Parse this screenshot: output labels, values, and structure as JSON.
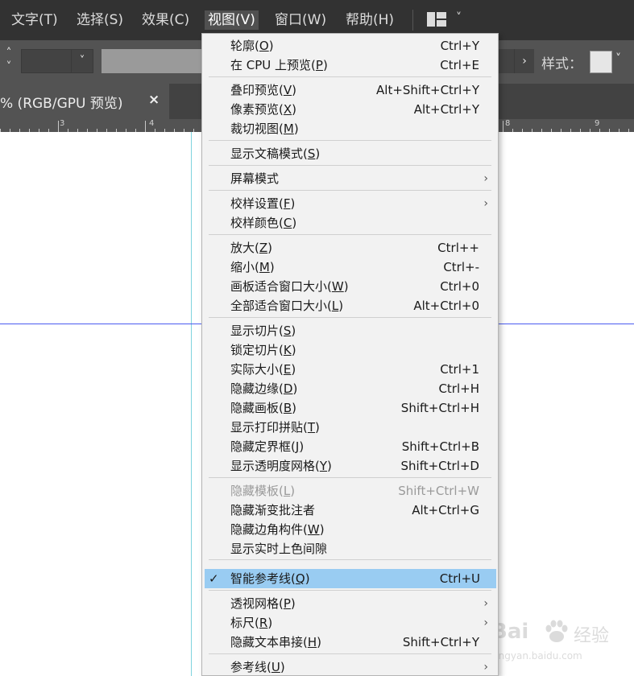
{
  "menubar": {
    "items": [
      "文字(T)",
      "选择(S)",
      "效果(C)",
      "视图(V)",
      "窗口(W)",
      "帮助(H)"
    ],
    "active_index": 3,
    "workspace_icon": "workspace-layout-icon",
    "workspace_caret": "˅"
  },
  "controlbar": {
    "style_label": "样式：",
    "spin_up": "˄",
    "spin_down": "˅",
    "select_caret": "˅",
    "next_arrow": "›",
    "style_caret": "˅"
  },
  "document_tab": {
    "title": "% (RGB/GPU 预览)",
    "close": "×"
  },
  "ruler": {
    "labels": [
      "3",
      "4",
      "8",
      "9"
    ]
  },
  "dropdown": {
    "items": [
      {
        "label": "轮廓",
        "key": "O",
        "shortcut": "Ctrl+Y"
      },
      {
        "label": "在 CPU 上预览",
        "key": "P",
        "shortcut": "Ctrl+E"
      },
      {
        "label": "叠印预览",
        "key": "V",
        "shortcut": "Alt+Shift+Ctrl+Y"
      },
      {
        "label": "像素预览",
        "key": "X",
        "shortcut": "Alt+Ctrl+Y"
      },
      {
        "label": "裁切视图",
        "key": "M",
        "shortcut": ""
      },
      {
        "label": "显示文稿模式",
        "key": "S",
        "shortcut": ""
      },
      {
        "label": "屏幕模式",
        "key": "",
        "shortcut": "",
        "submenu": true
      },
      {
        "label": "校样设置",
        "key": "F",
        "shortcut": "",
        "submenu": true
      },
      {
        "label": "校样颜色",
        "key": "C",
        "shortcut": ""
      },
      {
        "label": "放大",
        "key": "Z",
        "shortcut": "Ctrl++"
      },
      {
        "label": "缩小",
        "key": "M",
        "shortcut": "Ctrl+-"
      },
      {
        "label": "画板适合窗口大小",
        "key": "W",
        "shortcut": "Ctrl+0"
      },
      {
        "label": "全部适合窗口大小",
        "key": "L",
        "shortcut": "Alt+Ctrl+0"
      },
      {
        "label": "显示切片",
        "key": "S",
        "shortcut": ""
      },
      {
        "label": "锁定切片",
        "key": "K",
        "shortcut": ""
      },
      {
        "label": "实际大小",
        "key": "E",
        "shortcut": "Ctrl+1"
      },
      {
        "label": "隐藏边缘",
        "key": "D",
        "shortcut": "Ctrl+H"
      },
      {
        "label": "隐藏画板",
        "key": "B",
        "shortcut": "Shift+Ctrl+H"
      },
      {
        "label": "显示打印拼贴",
        "key": "T",
        "shortcut": ""
      },
      {
        "label": "隐藏定界框",
        "key": "J",
        "shortcut": "Shift+Ctrl+B"
      },
      {
        "label": "显示透明度网格",
        "key": "Y",
        "shortcut": "Shift+Ctrl+D"
      },
      {
        "label": "隐藏模板",
        "key": "L",
        "shortcut": "Shift+Ctrl+W",
        "disabled": true
      },
      {
        "label": "隐藏渐变批注者",
        "key": "",
        "shortcut": "Alt+Ctrl+G"
      },
      {
        "label": "隐藏边角构件",
        "key": "W",
        "shortcut": ""
      },
      {
        "label": "显示实时上色间隙",
        "key": "",
        "shortcut": ""
      },
      {
        "label": "智能参考线",
        "key": "Q",
        "shortcut": "Ctrl+U",
        "checked": true,
        "highlighted": true
      },
      {
        "label": "透视网格",
        "key": "P",
        "shortcut": "",
        "submenu": true
      },
      {
        "label": "标尺",
        "key": "R",
        "shortcut": "",
        "submenu": true
      },
      {
        "label": "隐藏文本串接",
        "key": "H",
        "shortcut": "Shift+Ctrl+Y"
      },
      {
        "label": "参考线",
        "key": "U",
        "shortcut": "",
        "submenu": true
      }
    ],
    "check_mark": "✓",
    "submenu_arrow": "›"
  },
  "watermark": {
    "brand": "Bai",
    "brand2": "经验",
    "url": "jingyan.baidu.com"
  },
  "colors": {
    "menubar_bg": "#323232",
    "controlbar_bg": "#535353",
    "menu_bg": "#f2f2f2",
    "highlight": "#99ccf2",
    "guide_vertical": "#7fd3de",
    "guide_horizontal": "#4a5cf0"
  }
}
